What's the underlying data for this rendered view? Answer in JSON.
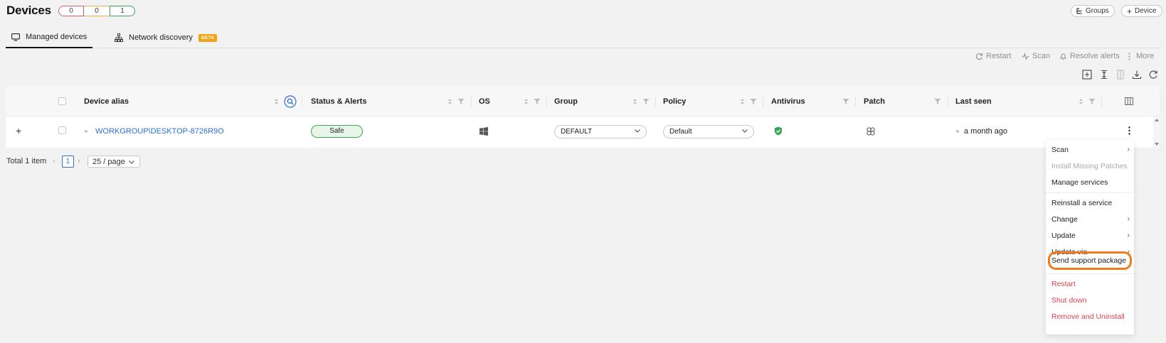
{
  "header": {
    "title": "Devices",
    "counters": [
      "0",
      "0",
      "1"
    ],
    "groups_label": "Groups",
    "device_label": "Device"
  },
  "tabs": [
    {
      "label": "Managed devices",
      "active": true
    },
    {
      "label": "Network discovery",
      "badge": "BETA"
    }
  ],
  "actions": {
    "restart": "Restart",
    "scan": "Scan",
    "resolve_alerts": "Resolve alerts",
    "more": "More"
  },
  "table": {
    "columns": {
      "device_alias": "Device alias",
      "status": "Status & Alerts",
      "os": "OS",
      "group": "Group",
      "policy": "Policy",
      "antivirus": "Antivirus",
      "patch": "Patch",
      "last_seen": "Last seen"
    },
    "rows": [
      {
        "expand": "+",
        "alias": "WORKGROUP\\DESKTOP-8726R9O",
        "status": "Safe",
        "os_icon": "windows-icon",
        "group": "DEFAULT",
        "policy": "Default",
        "antivirus_icon": "shield-check-icon",
        "patch_icon": "patch-icon",
        "last_seen": "a month ago"
      }
    ]
  },
  "pagination": {
    "total": "Total 1 item",
    "current_page": "1",
    "page_size": "25 / page"
  },
  "context_menu": {
    "items": [
      {
        "label": "Scan",
        "submenu": true
      },
      {
        "label": "Install Missing Patches",
        "disabled": true
      },
      {
        "label": "Manage services"
      },
      {
        "label": "Reinstall a service"
      },
      {
        "label": "Change",
        "submenu": true
      },
      {
        "label": "Update",
        "submenu": true
      },
      {
        "label": "Update via",
        "submenu": true
      },
      {
        "label": "Send support package",
        "highlighted": true
      },
      {
        "label": "Restart",
        "danger": true
      },
      {
        "label": "Shut down",
        "danger": true
      },
      {
        "label": "Remove and Uninstall",
        "danger": true
      }
    ]
  },
  "colors": {
    "accent_blue": "#2f6fd6",
    "safe_green": "#3aa656",
    "danger_red": "#e2414d",
    "highlight_orange": "#f07a1e",
    "beta_orange": "#f2a313"
  }
}
